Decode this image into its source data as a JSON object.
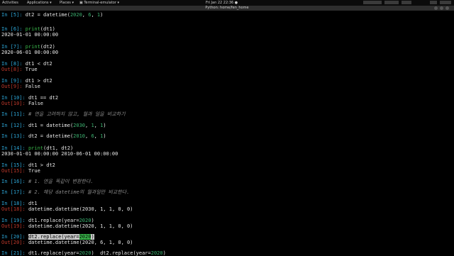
{
  "topbar": {
    "activities": "Activities",
    "applications": "Applications ▾",
    "places": "Places ▾",
    "terminal_app": "▣ Terminal-emulator ▾",
    "clock": "Fri Jan 22 22:36 ●"
  },
  "window": {
    "title": "Python: home/fen_home"
  },
  "colors": {
    "prompt_in": "#2eaadc",
    "prompt_out": "#c0392b",
    "number": "#3cb371",
    "keyword": "#39b54a",
    "comment": "#8a8a8a"
  },
  "lines": [
    {
      "kind": "in",
      "prompt": "In [5]: ",
      "parts": [
        [
          "dt2 = datetime(",
          ""
        ],
        [
          "2020",
          "num"
        ],
        [
          ", ",
          ""
        ],
        [
          "6",
          "num"
        ],
        [
          ", ",
          ""
        ],
        [
          "1",
          "num"
        ],
        [
          ")",
          ""
        ]
      ]
    },
    {
      "kind": "in",
      "prompt": "In [6]: ",
      "parts": [
        [
          "print",
          "kw"
        ],
        [
          "(dt1)",
          ""
        ]
      ]
    },
    {
      "kind": "plain",
      "parts": [
        [
          "2020-01-01 00:00:00",
          ""
        ]
      ]
    },
    {
      "kind": "in",
      "prompt": "In [7]: ",
      "parts": [
        [
          "print",
          "kw"
        ],
        [
          "(dt2)",
          ""
        ]
      ]
    },
    {
      "kind": "plain",
      "parts": [
        [
          "2020-06-01 00:00:00",
          ""
        ]
      ]
    },
    {
      "kind": "in",
      "prompt": "In [8]: ",
      "parts": [
        [
          "dt1 < dt2",
          ""
        ]
      ]
    },
    {
      "kind": "out",
      "prompt": "Out[8]: ",
      "parts": [
        [
          "True",
          ""
        ]
      ]
    },
    {
      "kind": "in",
      "prompt": "In [9]: ",
      "parts": [
        [
          "dt1 > dt2",
          ""
        ]
      ]
    },
    {
      "kind": "out",
      "prompt": "Out[9]: ",
      "parts": [
        [
          "False",
          ""
        ]
      ]
    },
    {
      "kind": "in",
      "prompt": "In [10]: ",
      "parts": [
        [
          "dt1 == dt2",
          ""
        ]
      ]
    },
    {
      "kind": "out",
      "prompt": "Out[10]: ",
      "parts": [
        [
          "False",
          ""
        ]
      ]
    },
    {
      "kind": "in",
      "prompt": "In [11]: ",
      "parts": [
        [
          "# 연을 고려하지 않고, 월과 일을 비교하기",
          "cm"
        ]
      ]
    },
    {
      "kind": "in",
      "prompt": "In [12]: ",
      "parts": [
        [
          "dt1 = datetime(",
          ""
        ],
        [
          "2030",
          "num"
        ],
        [
          ", ",
          ""
        ],
        [
          "1",
          "num"
        ],
        [
          ", ",
          ""
        ],
        [
          "1",
          "num"
        ],
        [
          ")",
          ""
        ]
      ]
    },
    {
      "kind": "in",
      "prompt": "In [13]: ",
      "parts": [
        [
          "dt2 = datetime(",
          ""
        ],
        [
          "2010",
          "num"
        ],
        [
          ", ",
          ""
        ],
        [
          "6",
          "num"
        ],
        [
          ", ",
          ""
        ],
        [
          "1",
          "num"
        ],
        [
          ")",
          ""
        ]
      ]
    },
    {
      "kind": "in",
      "prompt": "In [14]: ",
      "parts": [
        [
          "print",
          "kw"
        ],
        [
          "(dt1, dt2)",
          ""
        ]
      ]
    },
    {
      "kind": "plain",
      "parts": [
        [
          "2030-01-01 00:00:00 2010-06-01 00:00:00",
          ""
        ]
      ]
    },
    {
      "kind": "in",
      "prompt": "In [15]: ",
      "parts": [
        [
          "dt1 > dt2",
          ""
        ]
      ]
    },
    {
      "kind": "out",
      "prompt": "Out[15]: ",
      "parts": [
        [
          "True",
          ""
        ]
      ]
    },
    {
      "kind": "in",
      "prompt": "In [16]: ",
      "parts": [
        [
          "# 1. 연을 똑같이 변환한다.",
          "cm"
        ]
      ]
    },
    {
      "kind": "in",
      "prompt": "In [17]: ",
      "parts": [
        [
          "# 2. 해당 datetime의 월과일만 비교한다.",
          "cm"
        ]
      ]
    },
    {
      "kind": "in",
      "prompt": "In [18]: ",
      "parts": [
        [
          "dt1",
          ""
        ]
      ]
    },
    {
      "kind": "out",
      "prompt": "Out[18]: ",
      "parts": [
        [
          "datetime.datetime(2030, 1, 1, 0, 0)",
          ""
        ]
      ]
    },
    {
      "kind": "in",
      "prompt": "In [19]: ",
      "parts": [
        [
          "dt1.replace(year=",
          ""
        ],
        [
          "2020",
          "num"
        ],
        [
          ")",
          ""
        ]
      ]
    },
    {
      "kind": "out",
      "prompt": "Out[19]: ",
      "parts": [
        [
          "datetime.datetime(2020, 1, 1, 0, 0)",
          ""
        ]
      ]
    },
    {
      "kind": "in",
      "prompt": "In [20]: ",
      "parts": [
        [
          "dt2.replace(year=",
          "sel"
        ],
        [
          "2020",
          "selnum"
        ],
        [
          ")",
          "sel"
        ]
      ]
    },
    {
      "kind": "out",
      "prompt": "Out[20]: ",
      "parts": [
        [
          "datetime.datetime(2020, 6, 1, 0, 0)",
          ""
        ]
      ]
    },
    {
      "kind": "in",
      "prompt": "In [21]: ",
      "parts": [
        [
          "dt1.replace(year=",
          ""
        ],
        [
          "2020",
          "num"
        ],
        [
          ")  dt2.replace(year=",
          ""
        ],
        [
          "2020",
          "num"
        ],
        [
          ")",
          ""
        ]
      ]
    }
  ]
}
